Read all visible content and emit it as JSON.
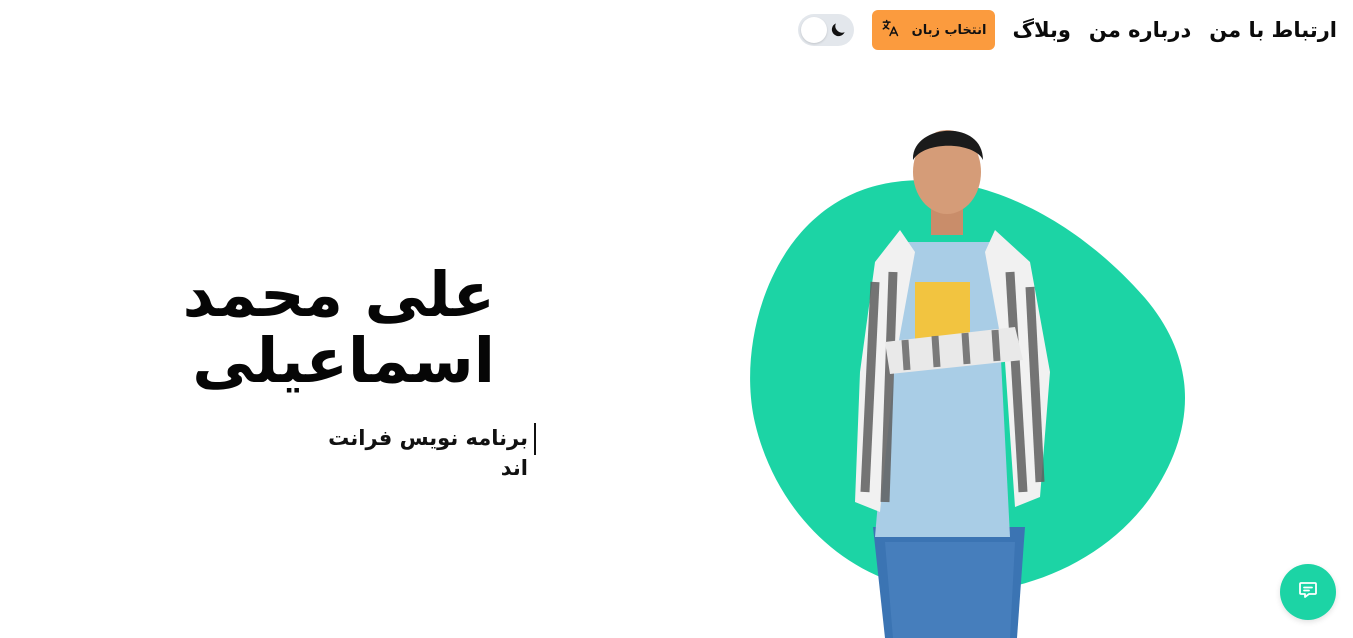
{
  "nav": {
    "contact_label": "ارتباط با من",
    "about_label": "درباره من",
    "blog_label": "وبلاگ",
    "language_label": "انتخاب زبان"
  },
  "theme_toggle": {
    "state": "light",
    "icon": "moon-icon"
  },
  "hero": {
    "name_line1": "علی محمد",
    "name_line2": "اسماعیلی",
    "role": "برنامه نویس فرانت اند"
  },
  "colors": {
    "accent": "#1cd4a5",
    "language_button": "#fb9b3e",
    "toggle_track": "#e3e7ec",
    "text": "#0b0b0b"
  },
  "icons": {
    "language": "translate-icon",
    "theme": "moon-icon",
    "chat": "chat-bubble-icon"
  }
}
